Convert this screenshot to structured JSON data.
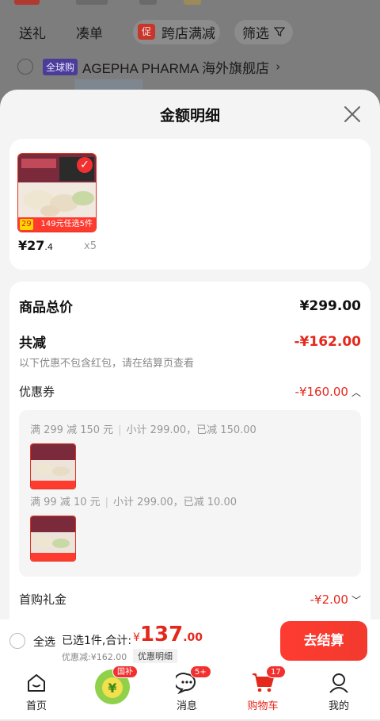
{
  "background": {
    "filters": [
      "送礼",
      "凑单",
      "跨店满减",
      "筛选"
    ],
    "promo_tag": "促",
    "store_badge": "全球购",
    "store_name": "AGEPHA PHARMA 海外旗舰店",
    "store_chevron": "›"
  },
  "sheet": {
    "title": "金额明细",
    "close_icon": "close-icon"
  },
  "product": {
    "price_whole": "¥27",
    "price_decimal": ".4",
    "quantity": "x5",
    "image_price_tag": "29",
    "image_promo": "149元任选5件"
  },
  "summary": {
    "total_label": "商品总价",
    "total_value": "¥299.00",
    "reduce_label": "共减",
    "reduce_value": "-¥162.00",
    "reduce_note": "以下优惠不包含红包，请在结算页查看",
    "coupon_label": "优惠券",
    "coupon_value": "-¥160.00",
    "coupon_line1_rule": "满 299 减 150 元",
    "coupon_line1_detail": "小计 299.00，已减 150.00",
    "coupon_line2_rule": "满 99 减 10 元",
    "coupon_line2_detail": "小计 299.00，已减 10.00",
    "first_gift_label": "首购礼金",
    "first_gift_value": "-¥2.00"
  },
  "checkout": {
    "select_all": "全选",
    "selected_text": "已选1件,合计:",
    "total_symbol": "¥",
    "total_integer": "137",
    "total_decimal": ".00",
    "discount_text": "优惠减:¥162.00",
    "detail_button": "优惠明细",
    "submit_button": "去结算"
  },
  "tabbar": {
    "items": [
      {
        "label": "首页",
        "icon": "home-icon"
      },
      {
        "label": "",
        "icon": "subsidy-icon",
        "badge": "国补"
      },
      {
        "label": "消息",
        "icon": "message-icon",
        "badge": "5+"
      },
      {
        "label": "购物车",
        "icon": "cart-icon",
        "badge": "17"
      },
      {
        "label": "我的",
        "icon": "profile-icon"
      }
    ]
  },
  "colors": {
    "accent_red": "#e4281c",
    "button_red": "#ff3b30",
    "subsidy_green": "#8fd14a"
  }
}
